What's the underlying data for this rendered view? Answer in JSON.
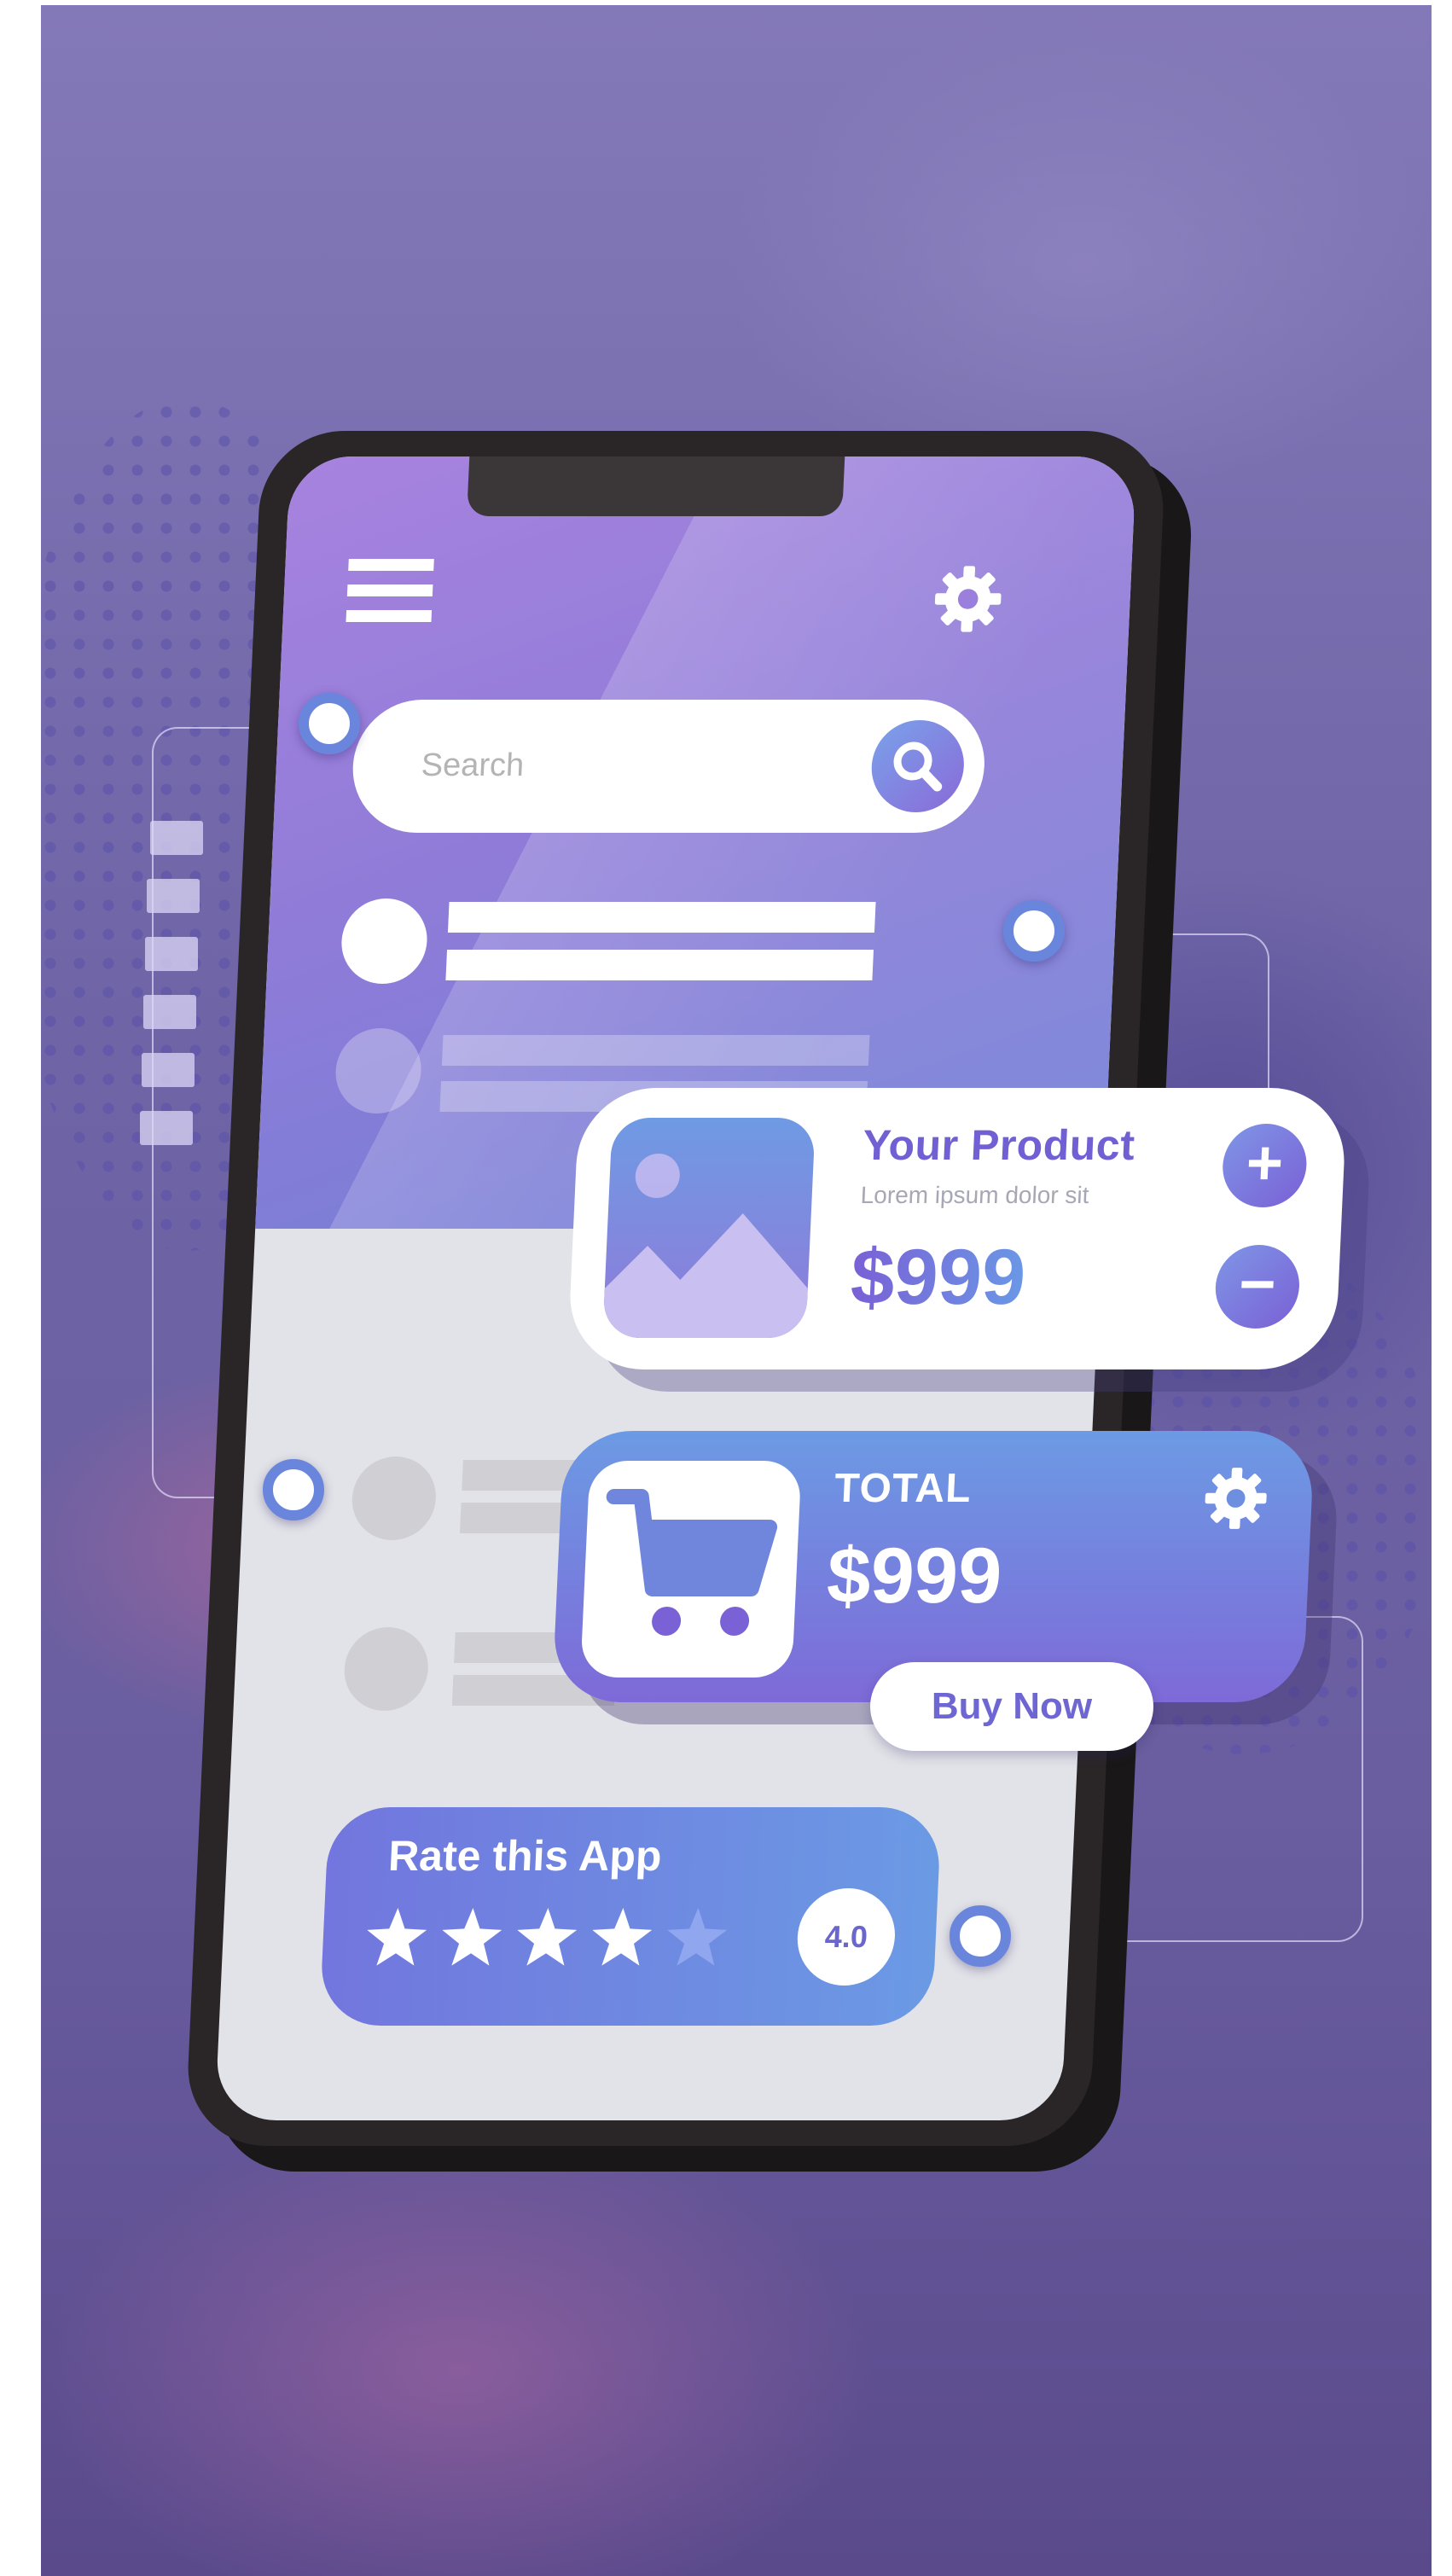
{
  "search": {
    "placeholder": "Search"
  },
  "product": {
    "title": "Your Product",
    "subtitle": "Lorem ipsum dolor sit",
    "price": "$999",
    "increase_label": "+",
    "decrease_label": "−"
  },
  "total": {
    "label": "TOTAL",
    "price": "$999",
    "buy_label": "Buy Now"
  },
  "rating": {
    "title": "Rate this App",
    "value": "4.0",
    "stars_filled": 4,
    "stars_total": 5
  },
  "colors": {
    "accent_purple": "#7a60d6",
    "accent_blue": "#6b9ae4",
    "node_blue": "#6a86dc",
    "screen_light": "#e2e3e8"
  },
  "icons": {
    "menu": "hamburger-menu-icon",
    "settings": "gear-icon",
    "search": "magnifier-icon",
    "product_image": "image-placeholder-icon",
    "cart": "shopping-cart-icon",
    "star": "star-icon"
  }
}
